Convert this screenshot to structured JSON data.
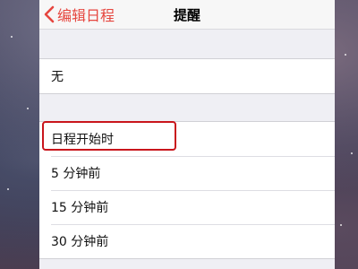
{
  "navbar": {
    "back_label": "编辑日程",
    "title": "提醒"
  },
  "groups": {
    "none_label": "无",
    "options": [
      "日程开始时",
      "5 分钟前",
      "15 分钟前",
      "30 分钟前"
    ]
  },
  "colors": {
    "accent": "#e6463f",
    "highlight_box": "#c9151c",
    "grouped_background": "#efeff4"
  }
}
